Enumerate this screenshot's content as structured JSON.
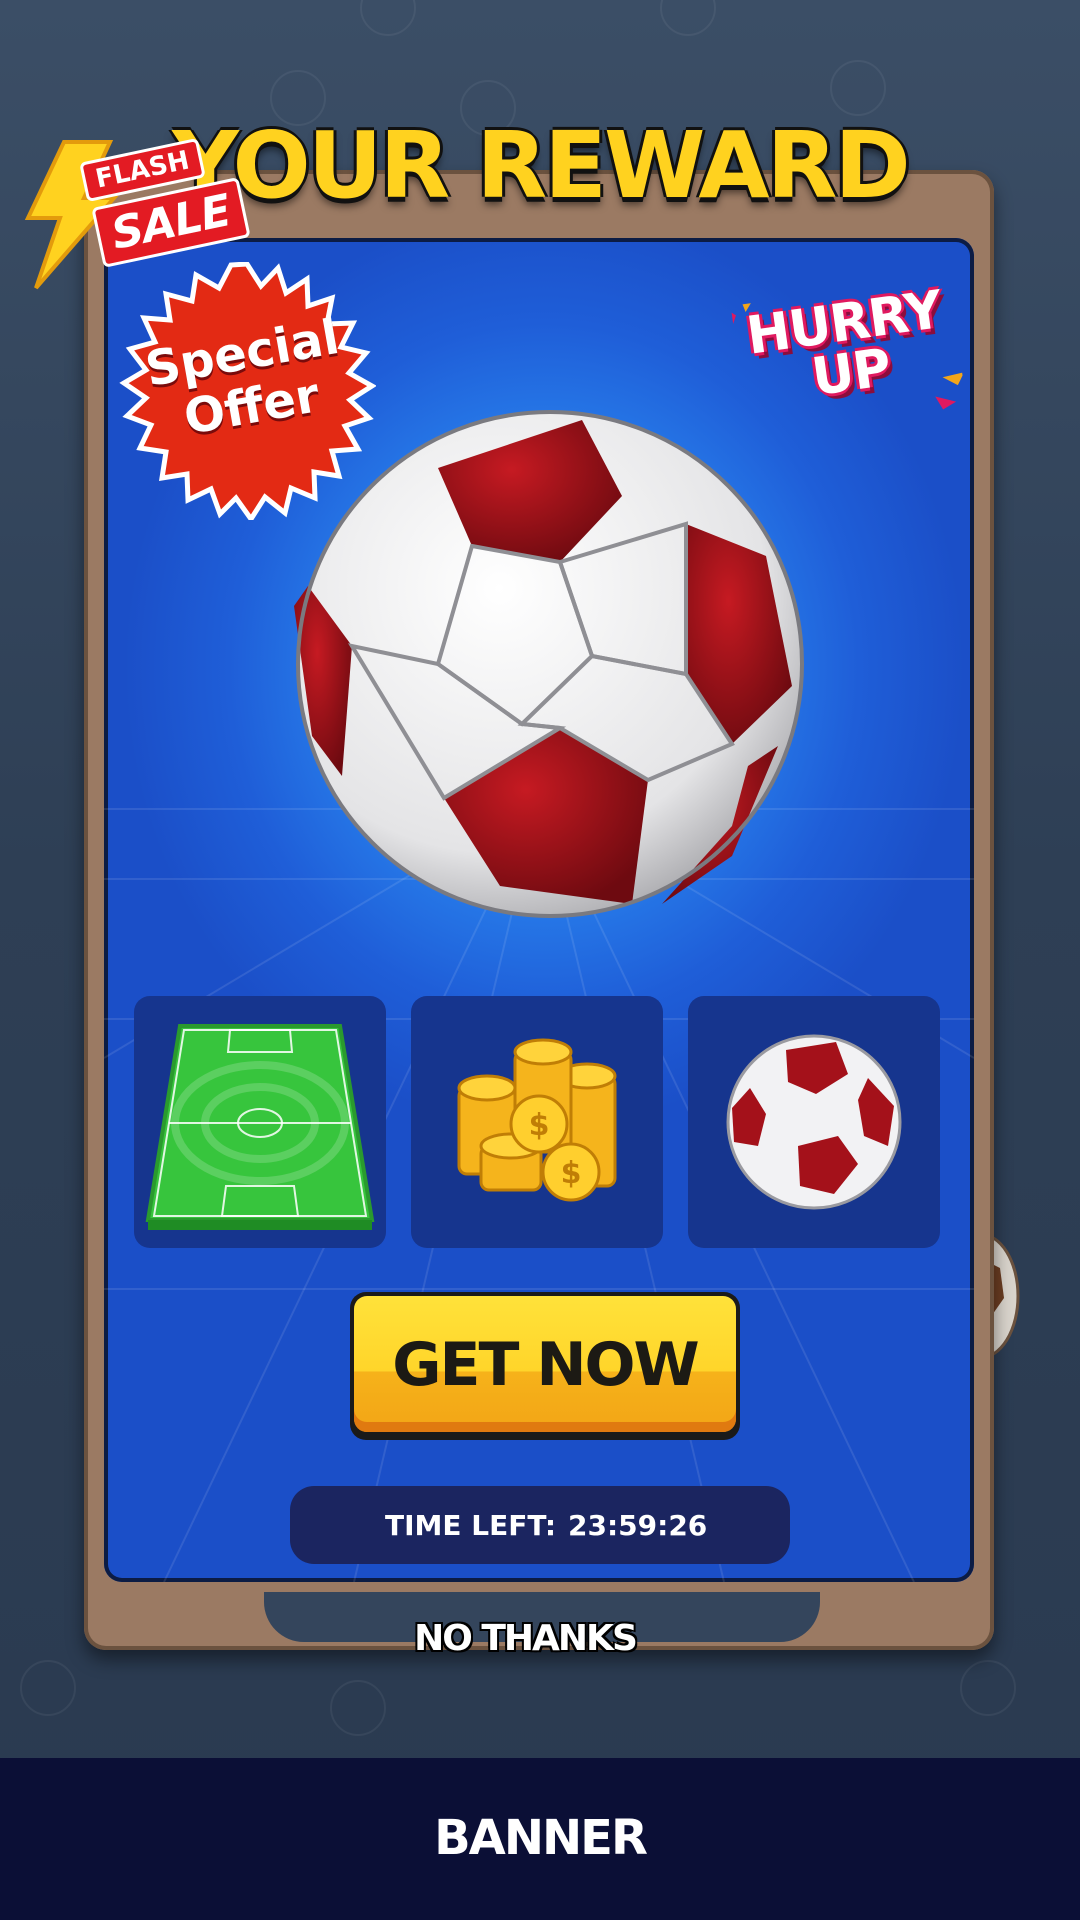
{
  "header": {
    "title": "YOUR REWARD"
  },
  "badges": {
    "flash_top": "FLASH",
    "flash_bottom": "SALE",
    "special_line1": "Special",
    "special_line2": "Offer",
    "hurry_line1": "HURRY",
    "hurry_line2": "UP"
  },
  "reward": {
    "main_item_icon": "soccer-ball-icon",
    "items": [
      {
        "icon": "soccer-field-icon"
      },
      {
        "icon": "gold-coins-icon"
      },
      {
        "icon": "soccer-ball-icon"
      }
    ]
  },
  "actions": {
    "get_now_label": "GET NOW",
    "no_thanks_label": "NO THANKS"
  },
  "timer": {
    "label": "TIME LEFT:",
    "value": "23:59:26"
  },
  "banner": {
    "label": "BANNER"
  },
  "colors": {
    "title_yellow": "#ffd21f",
    "panel_blue": "#1f5ed8",
    "button_yellow": "#ffd52a",
    "frame_brown": "#9b7a63",
    "banner_navy": "#0b0f36",
    "ball_red": "#a4111a"
  }
}
